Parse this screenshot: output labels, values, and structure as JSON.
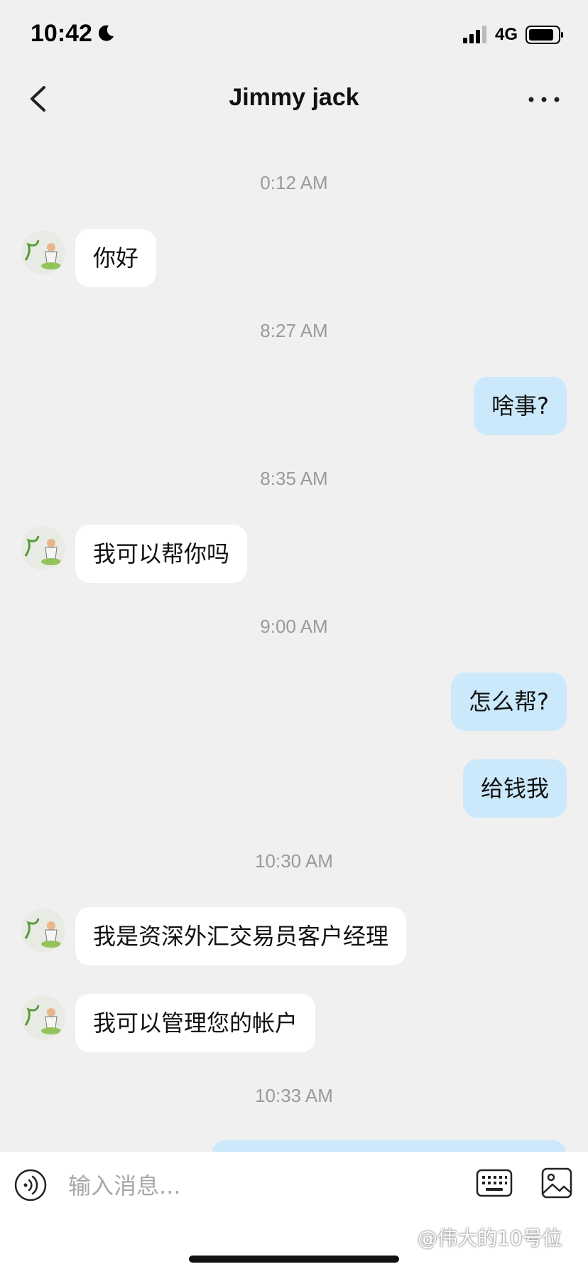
{
  "status_bar": {
    "time": "10:42",
    "network": "4G",
    "icons": [
      "moon-icon",
      "signal-icon",
      "battery-icon"
    ]
  },
  "nav": {
    "title": "Jimmy jack",
    "back_icon": "chevron-left-icon",
    "more_icon": "ellipsis-icon"
  },
  "messages": [
    {
      "type": "time",
      "text": "0:12 AM"
    },
    {
      "type": "in",
      "text": "你好"
    },
    {
      "type": "time",
      "text": "8:27 AM"
    },
    {
      "type": "out",
      "text": "啥事?"
    },
    {
      "type": "time",
      "text": "8:35 AM"
    },
    {
      "type": "in",
      "text": "我可以帮你吗"
    },
    {
      "type": "time",
      "text": "9:00 AM"
    },
    {
      "type": "out",
      "text": "怎么帮?"
    },
    {
      "type": "out",
      "text": "给钱我"
    },
    {
      "type": "time",
      "text": "10:30 AM"
    },
    {
      "type": "in",
      "text": "我是资深外汇交易员客户经理"
    },
    {
      "type": "in",
      "text": "我可以管理您的帐户"
    },
    {
      "type": "time",
      "text": "10:33 AM"
    }
  ],
  "input_bar": {
    "placeholder": "输入消息...",
    "value": "",
    "icons": [
      "voice-icon",
      "keyboard-icon",
      "image-icon"
    ]
  },
  "watermark": "@伟大的10号位",
  "colors": {
    "background": "#f0f0f0",
    "incoming_bubble": "#ffffff",
    "outgoing_bubble": "#cce8fb",
    "timestamp": "#9a9a9a"
  }
}
